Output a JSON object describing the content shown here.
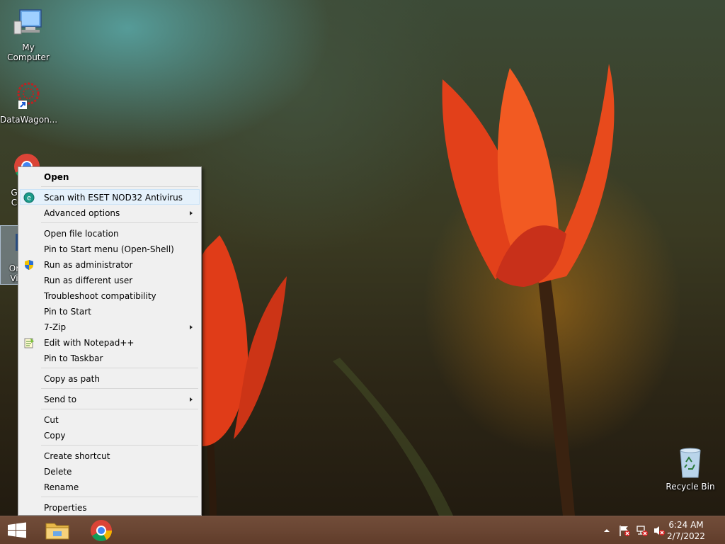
{
  "desktop": {
    "icons": [
      {
        "label": "My Computer"
      },
      {
        "label": "DataWagon..."
      },
      {
        "label": "G\nC"
      },
      {
        "label": "Or\nVi"
      },
      {
        "label": "Recycle Bin"
      }
    ]
  },
  "context_menu": {
    "items": {
      "open": "Open",
      "scan": "Scan with ESET NOD32 Antivirus",
      "advanced": "Advanced options",
      "open_location": "Open file location",
      "pin_start_menu": "Pin to Start menu (Open-Shell)",
      "run_admin": "Run as administrator",
      "run_diff_user": "Run as different user",
      "troubleshoot": "Troubleshoot compatibility",
      "pin_start": "Pin to Start",
      "zip": "7-Zip",
      "notepad": "Edit with Notepad++",
      "pin_taskbar": "Pin to Taskbar",
      "copy_path": "Copy as path",
      "send_to": "Send to",
      "cut": "Cut",
      "copy": "Copy",
      "create_shortcut": "Create shortcut",
      "delete": "Delete",
      "rename": "Rename",
      "properties": "Properties"
    },
    "highlight_color": "#e5f1fb"
  },
  "taskbar": {
    "time": "6:24 AM",
    "date": "2/7/2022",
    "color": "#6e4632"
  }
}
